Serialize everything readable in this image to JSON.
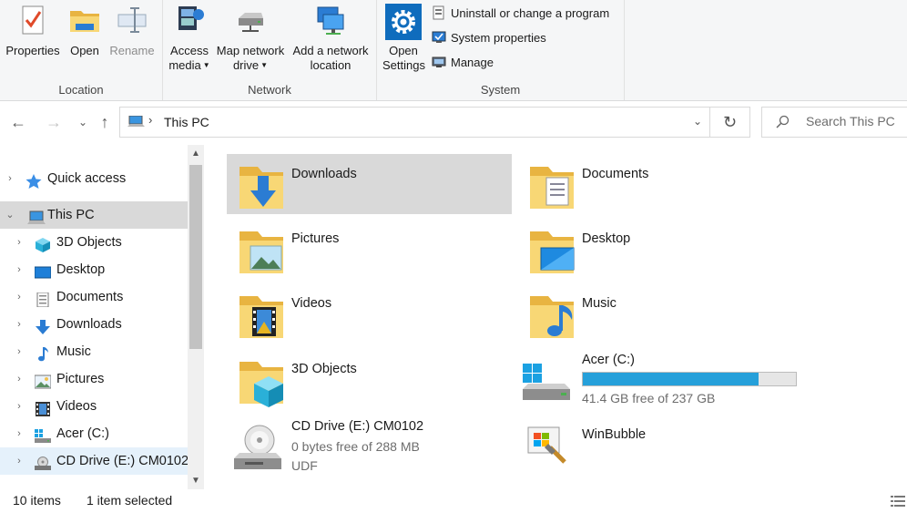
{
  "ribbon": {
    "location": {
      "label": "Location",
      "properties": "Properties",
      "open": "Open",
      "rename": "Rename"
    },
    "network": {
      "label": "Network",
      "access_media_1": "Access",
      "access_media_2": "media",
      "map_drive_1": "Map network",
      "map_drive_2": "drive",
      "add_location_1": "Add a network",
      "add_location_2": "location"
    },
    "system": {
      "label": "System",
      "open_settings_1": "Open",
      "open_settings_2": "Settings",
      "uninstall": "Uninstall or change a program",
      "system_properties": "System properties",
      "manage": "Manage"
    }
  },
  "address": {
    "crumb": "This PC",
    "search_placeholder": "Search This PC"
  },
  "nav_pane": {
    "items": [
      {
        "label": "Quick access"
      },
      {
        "label": "This PC"
      },
      {
        "label": "3D Objects"
      },
      {
        "label": "Desktop"
      },
      {
        "label": "Documents"
      },
      {
        "label": "Downloads"
      },
      {
        "label": "Music"
      },
      {
        "label": "Pictures"
      },
      {
        "label": "Videos"
      },
      {
        "label": "Acer (C:)"
      },
      {
        "label": "CD Drive (E:) CM0102"
      }
    ]
  },
  "content": {
    "folders": [
      {
        "name": "Downloads"
      },
      {
        "name": "Documents"
      },
      {
        "name": "Pictures"
      },
      {
        "name": "Desktop"
      },
      {
        "name": "Videos"
      },
      {
        "name": "Music"
      },
      {
        "name": "3D Objects"
      }
    ],
    "drive_c": {
      "name": "Acer (C:)",
      "free": "41.4 GB free of 237 GB",
      "used_fraction": 0.825
    },
    "cd_drive": {
      "name": "CD Drive (E:) CM0102",
      "free": "0 bytes free of 288 MB",
      "fs": "UDF"
    },
    "winbubble": {
      "name": "WinBubble"
    }
  },
  "status": {
    "items": "10 items",
    "selected": "1 item selected"
  },
  "colors": {
    "accent": "#26a0da",
    "selection": "#d9d9d9",
    "folder": "#f8d775"
  }
}
